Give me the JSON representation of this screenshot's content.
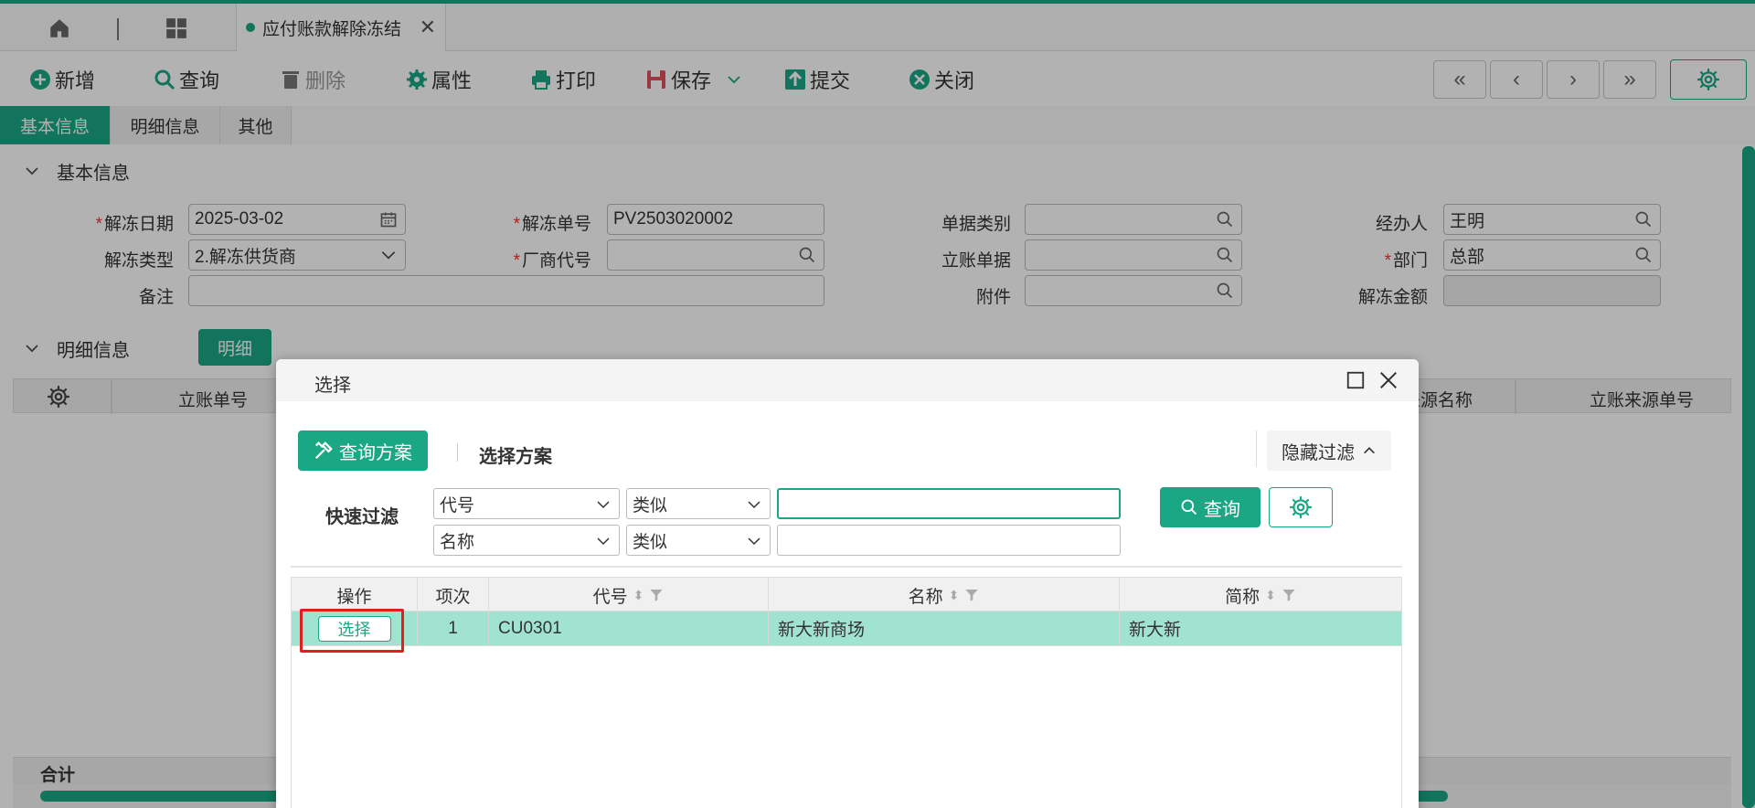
{
  "tabs": {
    "doc_tab": "应付账款解除冻结"
  },
  "toolbar": {
    "add": "新增",
    "query": "查询",
    "delete": "删除",
    "props": "属性",
    "print": "打印",
    "save": "保存",
    "submit": "提交",
    "close": "关闭"
  },
  "section_tabs": {
    "basic": "基本信息",
    "detail": "明细信息",
    "other": "其他"
  },
  "basic": {
    "header": "基本信息",
    "labels": {
      "date": "解冻日期",
      "no": "解冻单号",
      "doc_type": "单据类别",
      "handler": "经办人",
      "unfreeze_type": "解冻类型",
      "vendor_code": "厂商代号",
      "entry_doc": "立账单据",
      "dept": "部门",
      "remark": "备注",
      "attachment": "附件",
      "amount": "解冻金额"
    },
    "values": {
      "date": "2025-03-02",
      "no": "PV2503020002",
      "handler": "王明",
      "unfreeze_type": "2.解冻供货商",
      "dept": "总部"
    }
  },
  "detail": {
    "header": "明细信息",
    "button": "明细",
    "columns": {
      "entry_no": "立账单号",
      "source_name": "来源名称",
      "source_no": "立账来源单号"
    },
    "total": "合计"
  },
  "modal": {
    "title": "选择",
    "scheme_btn": "查询方案",
    "select_scheme": "选择方案",
    "hide_filter": "隐藏过滤",
    "quick_filter": "快速过滤",
    "filters": [
      {
        "field": "代号",
        "op": "类似",
        "value": ""
      },
      {
        "field": "名称",
        "op": "类似",
        "value": ""
      }
    ],
    "query_btn": "查询",
    "columns": {
      "action": "操作",
      "seq": "项次",
      "code": "代号",
      "name": "名称",
      "short": "简称"
    },
    "rows": [
      {
        "action": "选择",
        "seq": "1",
        "code": "CU0301",
        "name": "新大新商场",
        "short": "新大新"
      }
    ]
  },
  "colors": {
    "accent": "#1aa784",
    "row_highlight": "#9fe3d0",
    "annotation": "#e02020"
  }
}
